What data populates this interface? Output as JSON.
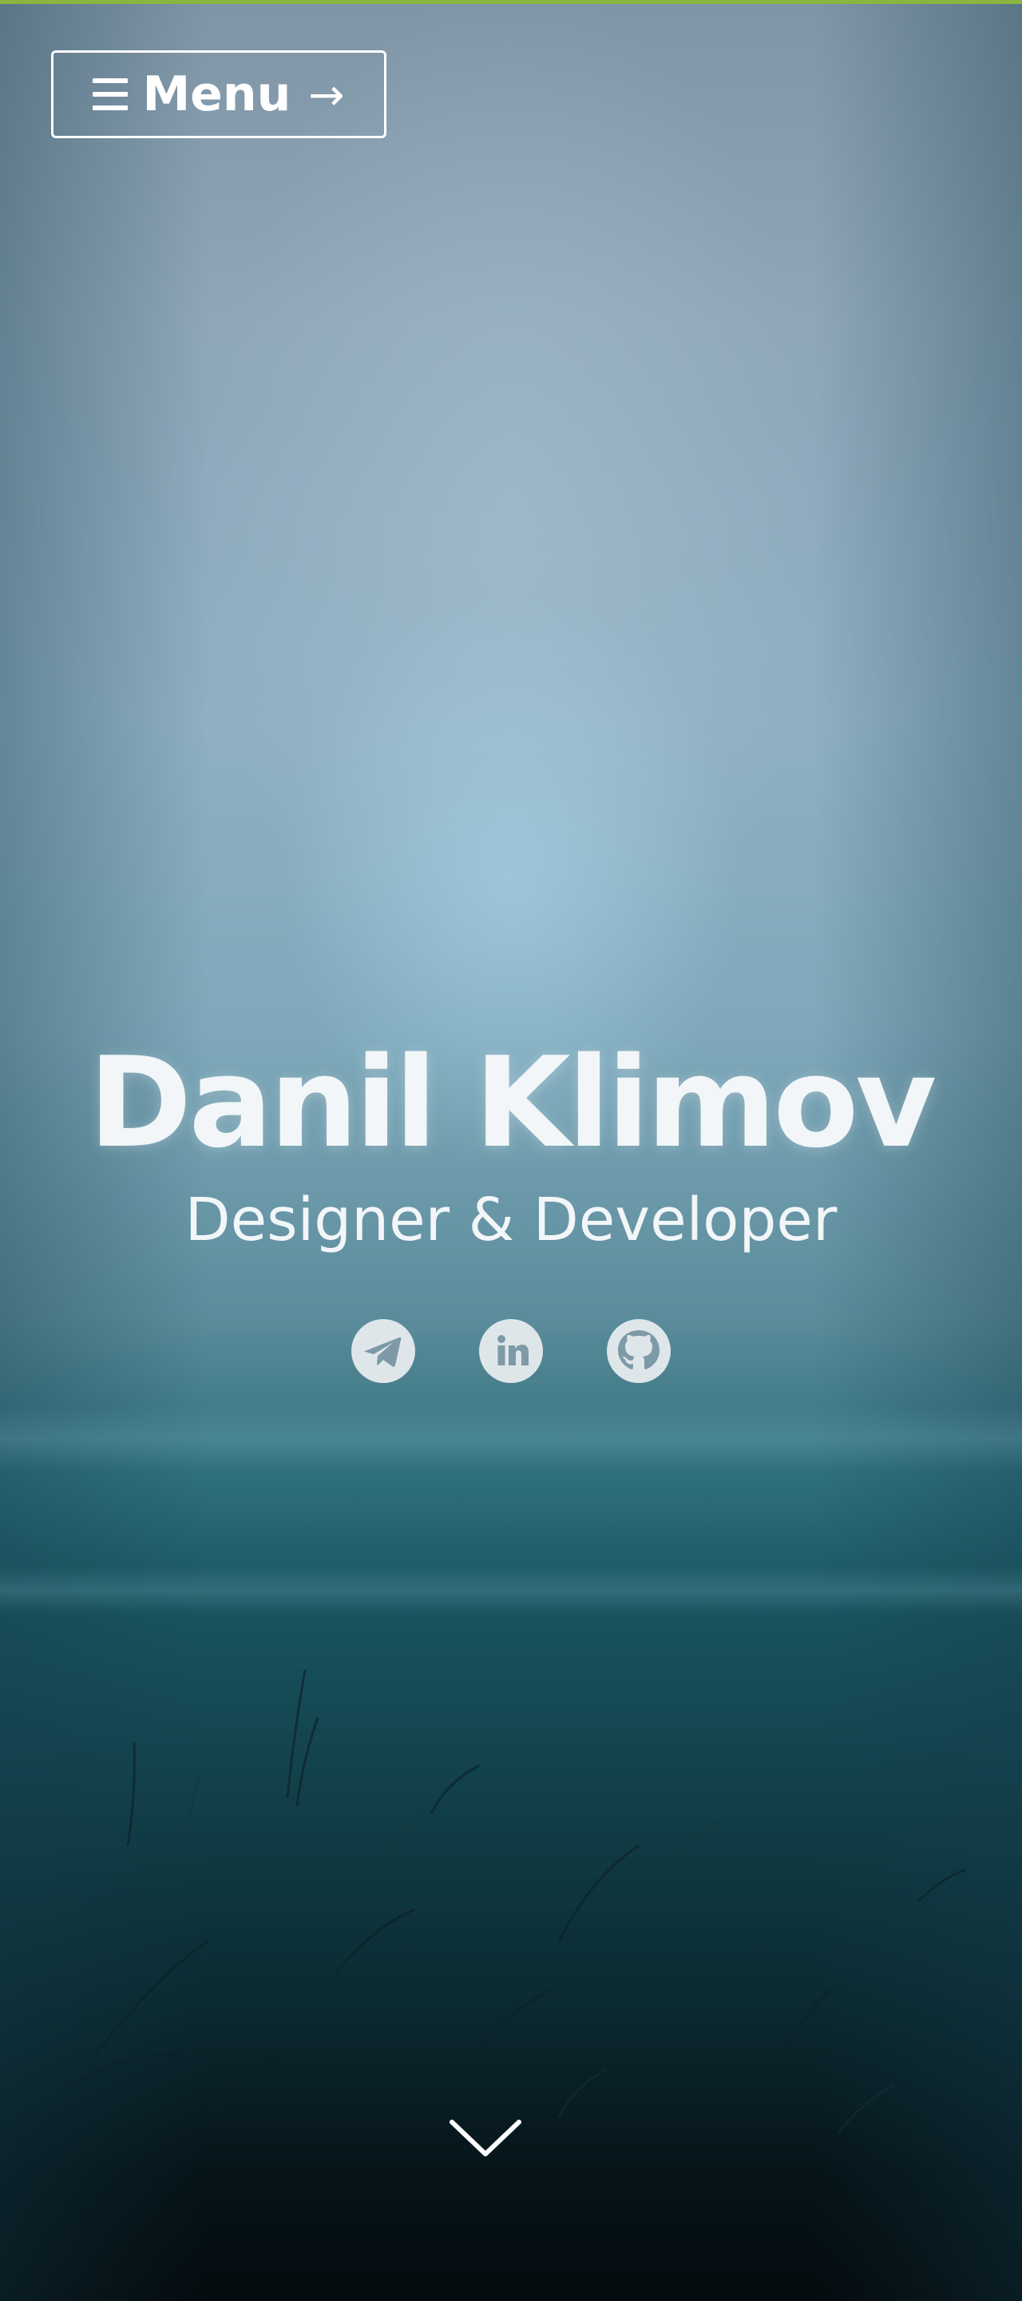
{
  "header": {
    "menu_label": "Menu",
    "menu_arrow": "→"
  },
  "hero": {
    "name": "Danil Klimov",
    "role": "Designer & Developer"
  },
  "socials": [
    {
      "name": "Telegram",
      "icon": "telegram-icon"
    },
    {
      "name": "LinkedIn",
      "icon": "linkedin-icon"
    },
    {
      "name": "GitHub",
      "icon": "github-icon"
    }
  ],
  "scroll_indicator": {
    "icon": "chevron-down-icon"
  },
  "colors": {
    "accent": "#8ab53e",
    "text": "#f2f6f8",
    "icon_background": "#dfe6ea",
    "icon_glyph": "#7d9aa6"
  }
}
